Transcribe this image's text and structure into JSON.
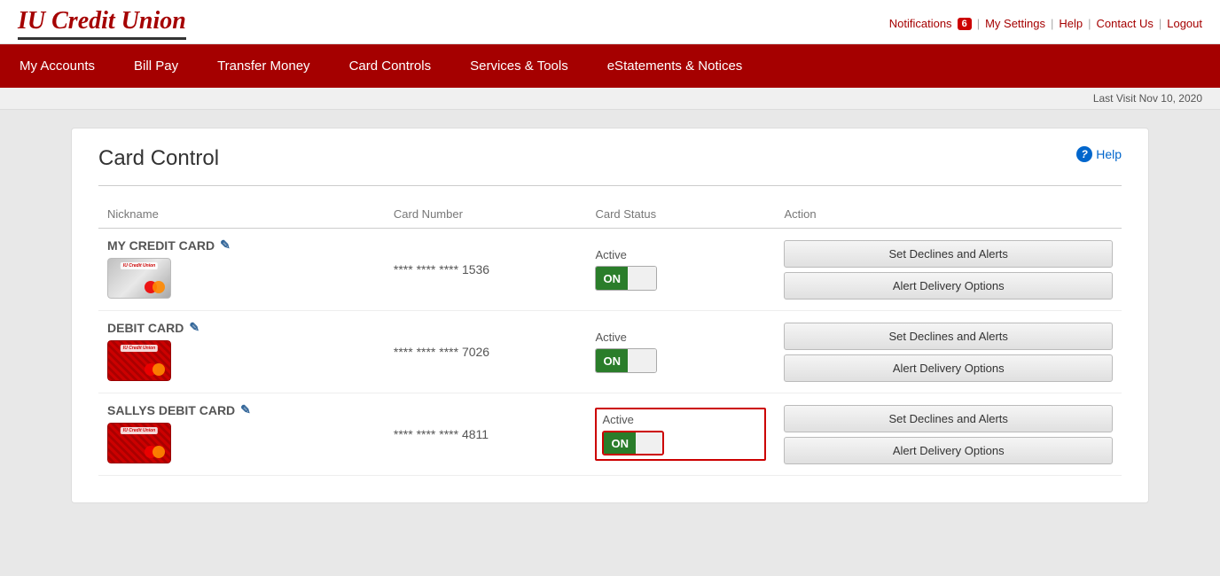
{
  "topNav": {
    "notifications_label": "Notifications",
    "notifications_count": "6",
    "my_settings": "My Settings",
    "help": "Help",
    "contact_us": "Contact Us",
    "logout": "Logout"
  },
  "logo": {
    "text": "IU Credit Union"
  },
  "mainNav": {
    "items": [
      {
        "label": "My Accounts",
        "id": "my-accounts"
      },
      {
        "label": "Bill Pay",
        "id": "bill-pay"
      },
      {
        "label": "Transfer Money",
        "id": "transfer-money"
      },
      {
        "label": "Card Controls",
        "id": "card-controls"
      },
      {
        "label": "Services & Tools",
        "id": "services-tools"
      },
      {
        "label": "eStatements & Notices",
        "id": "estatements"
      }
    ]
  },
  "lastVisit": "Last Visit Nov 10, 2020",
  "page": {
    "title": "Card Control",
    "help_label": "Help"
  },
  "table": {
    "headers": [
      "Nickname",
      "Card Number",
      "Card Status",
      "Action"
    ],
    "rows": [
      {
        "nickname": "MY CREDIT CARD",
        "card_number": "**** **** **** 1536",
        "card_type": "silver",
        "status_label": "Active",
        "toggle_on": "ON",
        "highlighted": false,
        "btn1": "Set Declines and Alerts",
        "btn2": "Alert Delivery Options"
      },
      {
        "nickname": "DEBIT CARD",
        "card_number": "**** **** **** 7026",
        "card_type": "red",
        "status_label": "Active",
        "toggle_on": "ON",
        "highlighted": false,
        "btn1": "Set Declines and Alerts",
        "btn2": "Alert Delivery Options"
      },
      {
        "nickname": "SALLYS DEBIT CARD",
        "card_number": "**** **** **** 4811",
        "card_type": "red",
        "status_label": "Active",
        "toggle_on": "ON",
        "highlighted": true,
        "btn1": "Set Declines and Alerts",
        "btn2": "Alert Delivery Options"
      }
    ]
  }
}
